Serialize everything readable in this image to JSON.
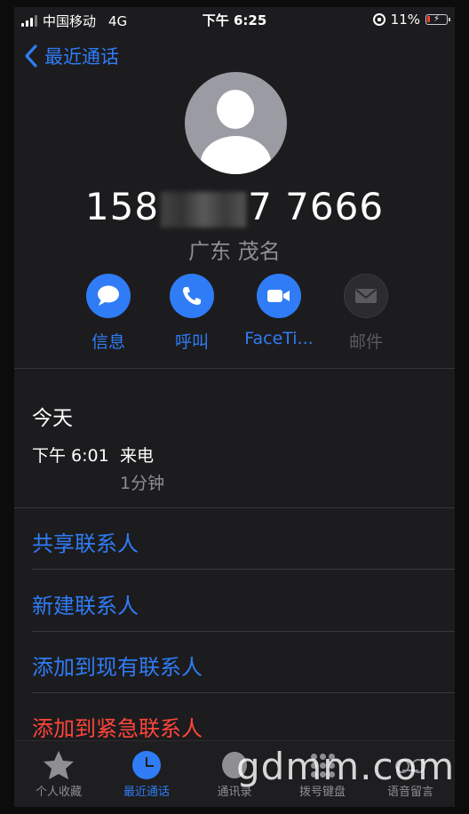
{
  "status_bar": {
    "carrier": "中国移动",
    "network": "4G",
    "time": "下午 6:25",
    "battery": "11%"
  },
  "nav": {
    "back_label": "最近通话"
  },
  "contact": {
    "number_prefix": "158",
    "number_suffix": "7 7666",
    "location": "广东 茂名"
  },
  "actions": [
    {
      "label": "信息",
      "icon": "message-icon",
      "enabled": true
    },
    {
      "label": "呼叫",
      "icon": "phone-icon",
      "enabled": true
    },
    {
      "label": "FaceTi...",
      "icon": "video-icon",
      "enabled": true
    },
    {
      "label": "邮件",
      "icon": "mail-icon",
      "enabled": false
    }
  ],
  "call_log": {
    "date_header": "今天",
    "entries": [
      {
        "time": "下午 6:01",
        "type": "来电",
        "duration": "1分钟"
      }
    ]
  },
  "menu": [
    {
      "label": "共享联系人"
    },
    {
      "label": "新建联系人"
    },
    {
      "label": "添加到现有联系人"
    },
    {
      "label": "添加到紧急联系人",
      "style": "danger"
    }
  ],
  "tabs": [
    {
      "label": "个人收藏",
      "icon": "star-icon"
    },
    {
      "label": "最近通话",
      "icon": "clock-icon",
      "active": true
    },
    {
      "label": "通讯录",
      "icon": "contacts-icon"
    },
    {
      "label": "拨号键盘",
      "icon": "keypad-icon"
    },
    {
      "label": "语音留言",
      "icon": "voicemail-icon"
    }
  ],
  "watermark": "gdmm.com",
  "colors": {
    "accent": "#2f7cf6",
    "danger": "#ff453a",
    "background": "#1c1c1e"
  }
}
